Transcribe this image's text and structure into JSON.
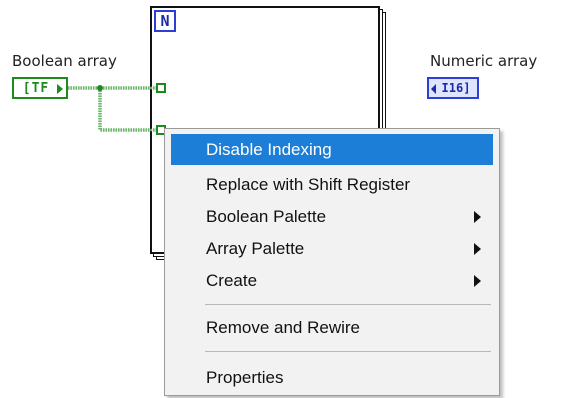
{
  "diagram": {
    "boolean_label": "Boolean array",
    "numeric_label": "Numeric array",
    "boolean_terminal_text": "[TF",
    "numeric_terminal_text": "I16]",
    "loop_count_text": "N",
    "colors": {
      "boolean_wire": "#1d8a1d",
      "numeric_terminal": "#2b3fd8",
      "menu_highlight": "#1c7ed6"
    }
  },
  "context_menu": {
    "items": [
      {
        "label": "Disable Indexing",
        "selected": true,
        "submenu": false
      },
      {
        "label": "Replace with Shift Register",
        "selected": false,
        "submenu": false
      },
      {
        "label": "Boolean Palette",
        "selected": false,
        "submenu": true
      },
      {
        "label": "Array Palette",
        "selected": false,
        "submenu": true
      },
      {
        "label": "Create",
        "selected": false,
        "submenu": true
      },
      {
        "label": "Remove and Rewire",
        "selected": false,
        "submenu": false
      },
      {
        "label": "Properties",
        "selected": false,
        "submenu": false
      }
    ]
  }
}
